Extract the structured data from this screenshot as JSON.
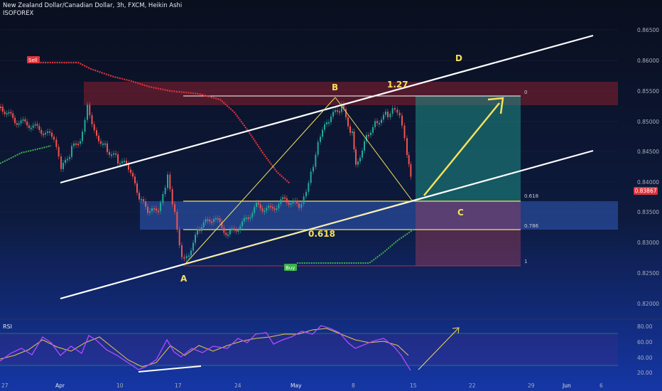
{
  "header": {
    "symbol_line": "New Zealand Dollar/Canadian Dollar, 3h, FXCM, Heikin Ashi",
    "author": "ISOFOREX"
  },
  "price_axis": {
    "labels": [
      "0.86500",
      "0.86000",
      "0.85500",
      "0.85000",
      "0.84500",
      "0.84000",
      "0.83500",
      "0.83000",
      "0.82500",
      "0.82000"
    ],
    "current_price": "0.83867"
  },
  "time_axis": {
    "labels": [
      "27",
      "Apr",
      "10",
      "17",
      "24",
      "May",
      "8",
      "15",
      "22",
      "29",
      "Jun",
      "6"
    ]
  },
  "annotations": {
    "point_a": "A",
    "point_b": "B",
    "point_c": "C",
    "point_d": "D",
    "ext_label": "1.27",
    "retrace_label": "0.618",
    "fib_0": "0",
    "fib_618": "0.618",
    "fib_786": "0.786",
    "fib_1": "1",
    "sell_tag": "Sell",
    "buy_tag": "Buy"
  },
  "rsi": {
    "title": "RSI",
    "labels": [
      "80.00",
      "60.00",
      "40.00",
      "20.00"
    ]
  },
  "colors": {
    "up_candle": "#26a69a",
    "down_candle": "#ef5350",
    "annotation_yellow": "#f5e15a",
    "sell_red": "#e0343c",
    "buy_green": "#3bb34a",
    "rsi_purple": "#b34bff",
    "rsi_signal": "#e8c84a"
  },
  "icons": [
    "arrow-up-right-icon"
  ]
}
